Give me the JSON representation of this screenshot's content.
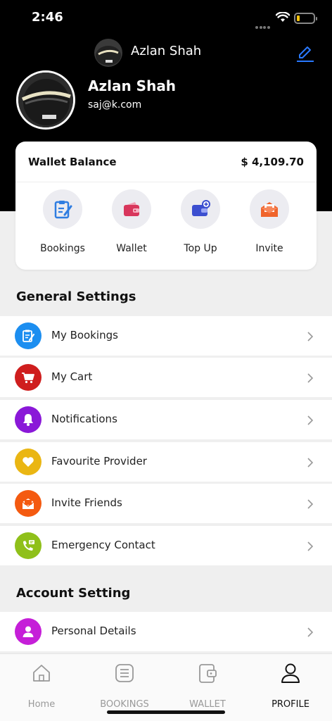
{
  "status_bar": {
    "time": "2:46"
  },
  "topbar": {
    "name": "Azlan Shah"
  },
  "profile": {
    "name": "Azlan Shah",
    "email": "saj@k.com"
  },
  "wallet": {
    "label": "Wallet Balance",
    "value": "$ 4,109.70",
    "actions": [
      {
        "label": "Bookings",
        "icon": "bookings-clipboard-icon",
        "color": "#2f7de1"
      },
      {
        "label": "Wallet",
        "icon": "wallet-icon",
        "color": "#d8365c"
      },
      {
        "label": "Top Up",
        "icon": "topup-wallet-icon",
        "color": "#3c4fd0"
      },
      {
        "label": "Invite",
        "icon": "envelope-icon",
        "color": "#f0642b"
      }
    ]
  },
  "general_settings": {
    "title": "General Settings",
    "items": [
      {
        "label": "My Bookings",
        "icon": "bookings-icon",
        "color": "#1c8ef0"
      },
      {
        "label": "My Cart",
        "icon": "cart-icon",
        "color": "#cf1e1e"
      },
      {
        "label": "Notifications",
        "icon": "bell-icon",
        "color": "#8a18d8"
      },
      {
        "label": "Favourite Provider",
        "icon": "heart-icon",
        "color": "#eab613"
      },
      {
        "label": "Invite Friends",
        "icon": "invite-envelope-icon",
        "color": "#f45a10"
      },
      {
        "label": "Emergency Contact",
        "icon": "phone-icon",
        "color": "#8fc01a"
      }
    ]
  },
  "account_setting": {
    "title": "Account Setting",
    "items": [
      {
        "label": "Personal Details",
        "icon": "user-icon",
        "color": "#c51fd8"
      }
    ]
  },
  "tabbar": {
    "tabs": [
      {
        "label": "Home",
        "icon": "home-icon"
      },
      {
        "label": "BOOKINGS",
        "icon": "list-icon"
      },
      {
        "label": "WALLET",
        "icon": "wallet-icon"
      },
      {
        "label": "PROFILE",
        "icon": "user-icon",
        "active": true
      }
    ]
  }
}
